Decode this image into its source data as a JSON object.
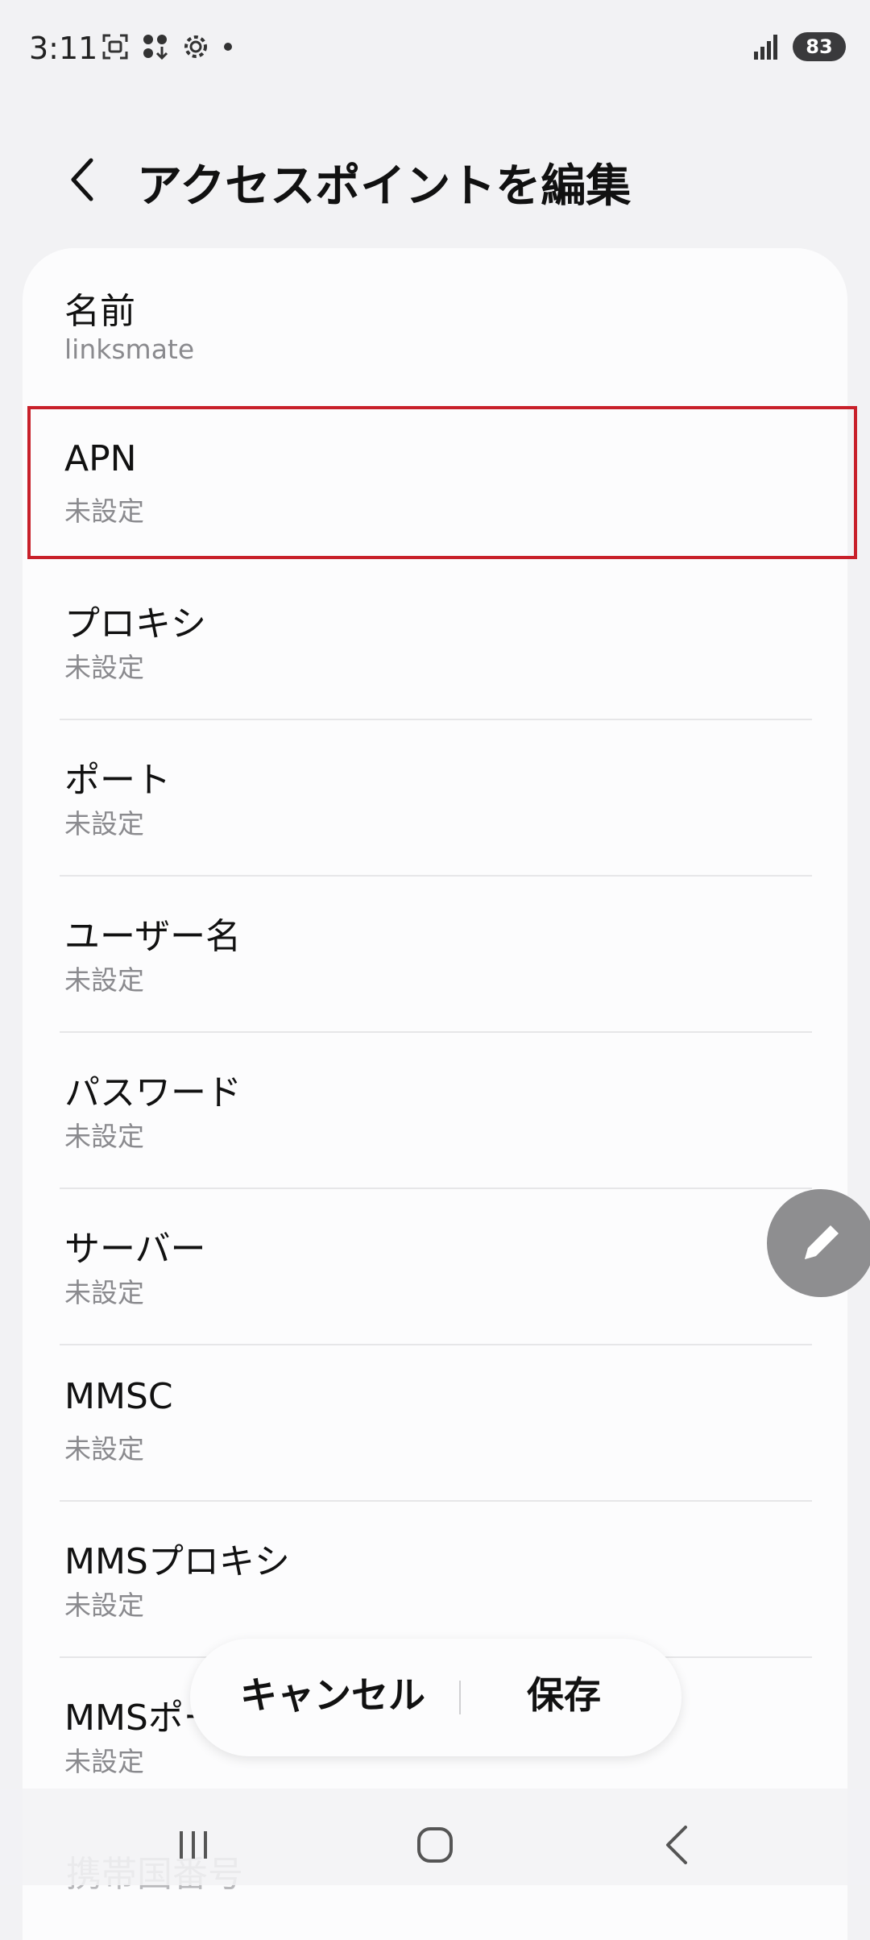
{
  "status_bar": {
    "time": "3:11",
    "battery": "83",
    "icons": [
      "screenshot-icon",
      "download-icon",
      "settings-icon",
      "notification-dot-icon",
      "signal-icon",
      "battery-icon"
    ]
  },
  "header": {
    "title": "アクセスポイントを編集",
    "back_icon": "chevron-left-icon"
  },
  "rows": [
    {
      "label": "名前",
      "value": "linksmate"
    },
    {
      "label": "APN",
      "value": "未設定"
    },
    {
      "label": "プロキシ",
      "value": "未設定"
    },
    {
      "label": "ポート",
      "value": "未設定"
    },
    {
      "label": "ユーザー名",
      "value": "未設定"
    },
    {
      "label": "パスワード",
      "value": "未設定"
    },
    {
      "label": "サーバー",
      "value": "未設定"
    },
    {
      "label": "MMSC",
      "value": "未設定"
    },
    {
      "label": "MMSプロキシ",
      "value": "未設定"
    },
    {
      "label": "MMSポート",
      "value": "未設定"
    }
  ],
  "clipped_row_label": "携帯国番号",
  "actions": {
    "cancel": "キャンセル",
    "save": "保存"
  },
  "fab_icon": "pencil-icon",
  "colors": {
    "highlight": "#c8202a",
    "background": "#f2f2f4",
    "card": "#fcfcfd"
  }
}
